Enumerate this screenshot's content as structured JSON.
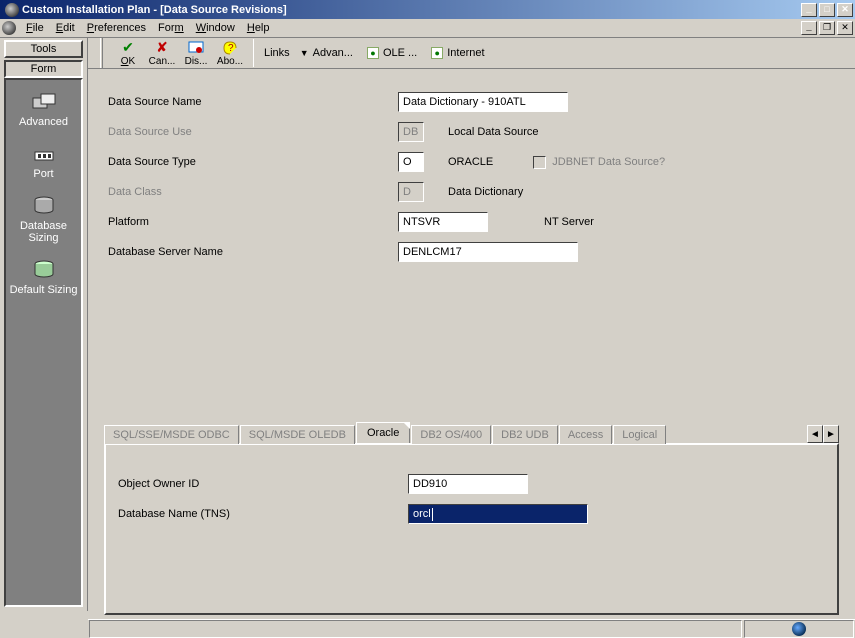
{
  "window": {
    "title": "Custom Installation Plan - [Data Source Revisions]"
  },
  "menu": {
    "file": "File",
    "edit": "Edit",
    "preferences": "Preferences",
    "form": "Form",
    "window": "Window",
    "help": "Help"
  },
  "toolbar": {
    "ok": "OK",
    "cancel": "Can...",
    "display": "Dis...",
    "about": "Abo...",
    "links": "Links",
    "advanced": "Advan...",
    "ole": "OLE ...",
    "internet": "Internet"
  },
  "sidebar": {
    "tools_header": "Tools",
    "form_header": "Form",
    "items": [
      {
        "label": "Advanced"
      },
      {
        "label": "Port"
      },
      {
        "label": "Database Sizing"
      },
      {
        "label": "Default Sizing"
      }
    ]
  },
  "form": {
    "r0": {
      "label": "Data Source Name",
      "value": "Data Dictionary - 910ATL"
    },
    "r1": {
      "label": "Data Source Use",
      "value": "DB",
      "desc": "Local Data Source"
    },
    "r2": {
      "label": "Data Source Type",
      "value": "O",
      "desc": "ORACLE"
    },
    "r3": {
      "label": "Data Class",
      "value": "D",
      "desc": "Data Dictionary"
    },
    "r4": {
      "label": "Platform",
      "value": "NTSVR",
      "desc": "NT Server"
    },
    "r5": {
      "label": "Database Server Name",
      "value": "DENLCM17"
    },
    "jdbnet": "JDBNET Data Source?"
  },
  "tabs": {
    "t0": "SQL/SSE/MSDE ODBC",
    "t1": "SQL/MSDE OLEDB",
    "t2": "Oracle",
    "t3": "DB2 OS/400",
    "t4": "DB2 UDB",
    "t5": "Access",
    "t6": "Logical"
  },
  "tabpanel": {
    "r0": {
      "label": "Object Owner ID",
      "value": "DD910"
    },
    "r1": {
      "label": "Database Name (TNS)",
      "value": "orcl"
    }
  }
}
